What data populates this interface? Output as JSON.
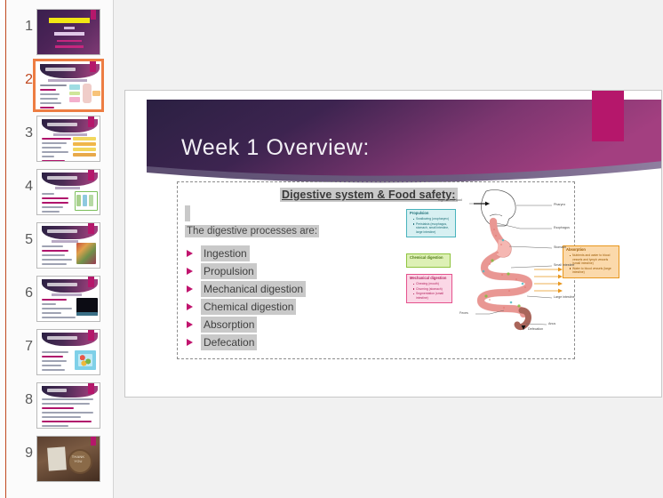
{
  "app": {
    "view": "powerpoint-normal-view"
  },
  "thumbnails": {
    "selected_index": 2,
    "items": [
      {
        "number": "1",
        "kind": "title-slide",
        "title": "DIGESTIVE SYSTEM",
        "line2": "BY",
        "line3": "Tomilson Usher",
        "line4": "Nursing · Anatomy",
        "line5": "Emory University"
      },
      {
        "number": "2",
        "kind": "content-diagram",
        "title": "Week 1 Overview:"
      },
      {
        "number": "3",
        "kind": "content-table",
        "title": "Week 1 Overview:"
      },
      {
        "number": "4",
        "kind": "content-images",
        "title": "Week 1 Overview:"
      },
      {
        "number": "5",
        "kind": "content-photo",
        "title": "Week 1 Overview:"
      },
      {
        "number": "6",
        "kind": "content-dark-photo",
        "title": "Week 1 Overview:"
      },
      {
        "number": "7",
        "kind": "content-food-photo",
        "title": "Week 1 Overview:"
      },
      {
        "number": "8",
        "kind": "references",
        "title": "References:"
      },
      {
        "number": "9",
        "kind": "thank-you",
        "title": "THANK YOU"
      }
    ]
  },
  "slide": {
    "title": "Week 1 Overview:",
    "section_heading": "Digestive system & Food safety:",
    "lead_line": "The digestive processes are:",
    "bullets": [
      "Ingestion",
      "Propulsion",
      "Mechanical digestion",
      "Chemical digestion",
      "Absorption",
      "Defecation"
    ],
    "accent_pink": "#b5176b",
    "banner_dark": "#2b2042",
    "banner_light": "#a53f80",
    "bullet_marker_color": "#c1146e",
    "selection_highlight": "#c9c9c9"
  },
  "diagram": {
    "name": "digestive-system-diagram",
    "boxes": [
      {
        "key": "propulsion",
        "title": "Propulsion",
        "color": "#49b3bd",
        "items": [
          "Swallowing (oropharynx)",
          "Peristalsis (esophagus, stomach, small intestine, large intestine)"
        ]
      },
      {
        "key": "chemical",
        "title": "Chemical digestion",
        "color": "#8fc43e",
        "items": []
      },
      {
        "key": "mechanical",
        "title": "Mechanical digestion",
        "color": "#e5528d",
        "items": [
          "Chewing (mouth)",
          "Churning (stomach)",
          "Segmentation (small intestine)"
        ]
      },
      {
        "key": "absorption",
        "title": "Absorption",
        "color": "#e8971e",
        "items": [
          "Nutrients and water to blood vessels and lymph vessels (small intestine)",
          "Water to blood vessels (large intestine)"
        ]
      }
    ],
    "labels": [
      "Ingestion of food",
      "Pharynx",
      "Esophagus",
      "Stomach",
      "Small intestine",
      "Large intestine",
      "Feces",
      "Anus",
      "Defecation"
    ]
  }
}
